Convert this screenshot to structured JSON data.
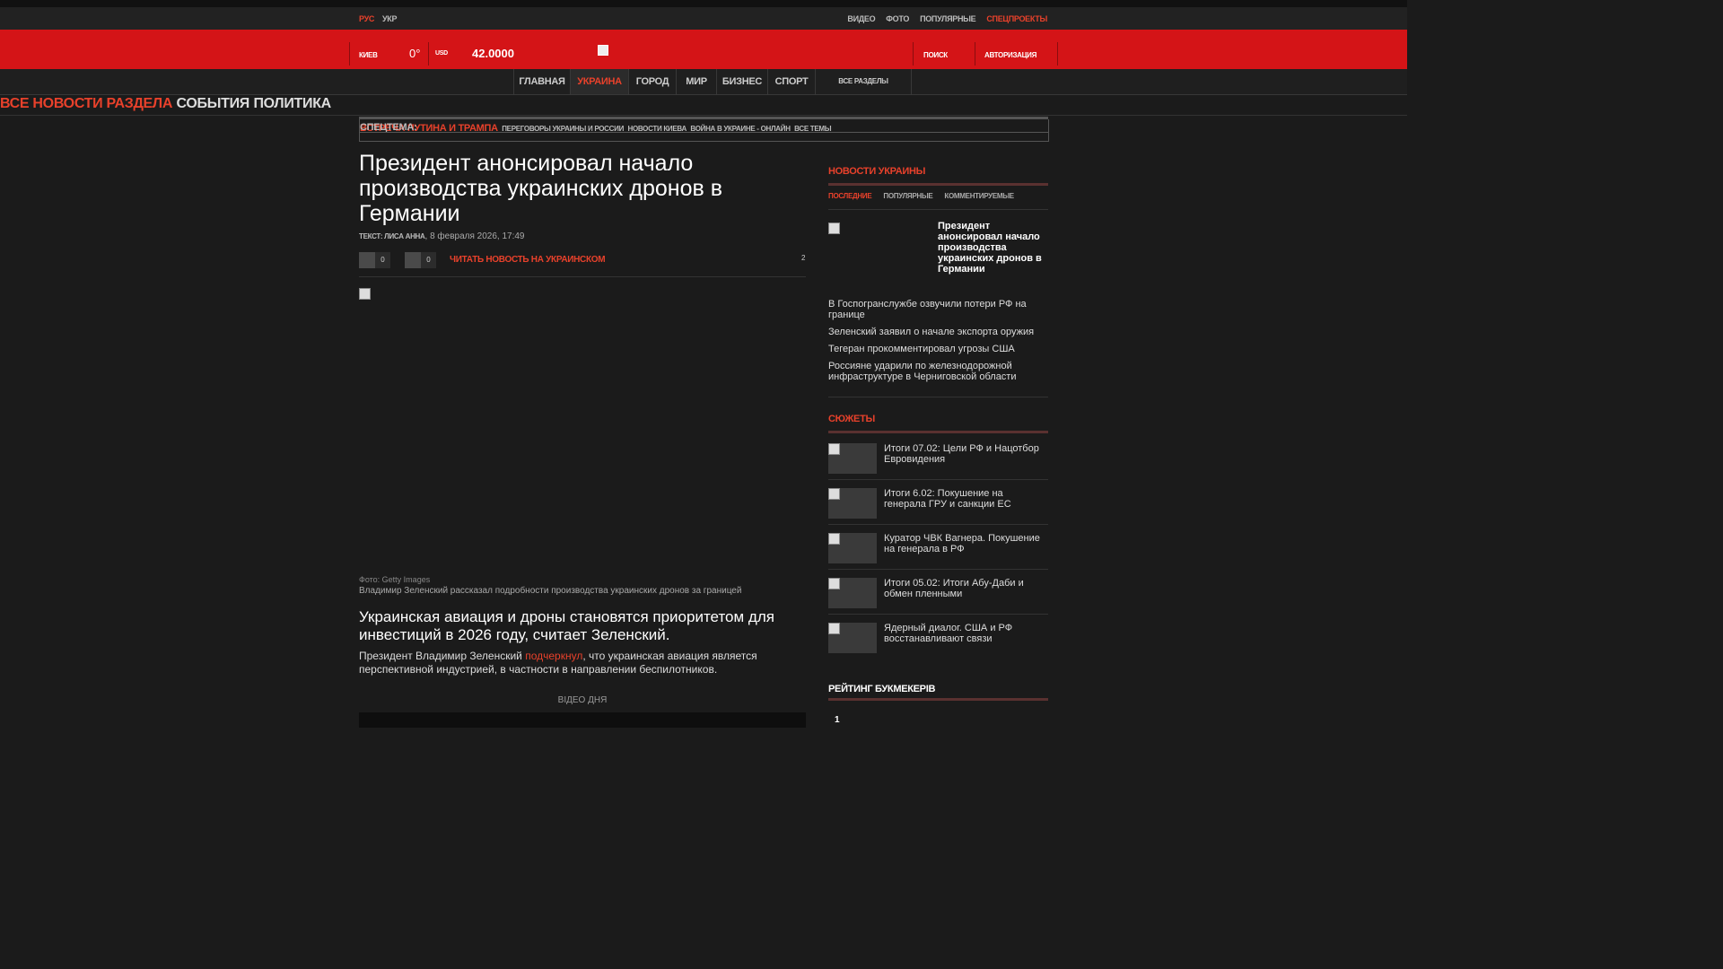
{
  "topbar": {
    "lang_rus": "РУС",
    "lang_ukr": "УКР",
    "links": [
      "ВИДЕО",
      "ФОТО",
      "ПОПУЛЯРНЫЕ",
      "СПЕЦПРОЕКТЫ"
    ]
  },
  "header": {
    "city": "КИЕВ",
    "temperature": "0°",
    "currency_label": "USD",
    "currency_value": "42.0000",
    "search": "ПОИСК",
    "auth": "АВТОРИЗАЦИЯ"
  },
  "nav": {
    "items": [
      "ГЛАВНАЯ",
      "УКРАИНА",
      "ГОРОД",
      "МИР",
      "БИЗНЕС",
      "СПОРТ"
    ],
    "all_sections": "ВСЕ РАЗДЕЛЫ"
  },
  "subnav": {
    "all": "ВСЕ НОВОСТИ РАЗДЕЛА",
    "events": "СОБЫТИЯ",
    "politics": "ПОЛИТИКА"
  },
  "special": {
    "label": "СПЕЦТЕМА:",
    "main": "ВСТРЕЧА ПУТИНА И ТРАМПА",
    "links": [
      "ПЕРЕГОВОРЫ УКРАИНЫ И РОССИИ",
      "НОВОСТИ КИЕВА",
      "ВОЙНА В УКРАИНЕ - ОНЛАЙН"
    ],
    "all": "ВСЕ ТЕМЫ"
  },
  "article": {
    "title": "Президент анонсировал начало производства украинских дронов в Германии",
    "author": "ТЕКСТ: ЛИСА АННА",
    "date": "8 февраля 2026, 17:49",
    "likes_1": "0",
    "likes_2": "0",
    "read_ukr": "ЧИТАТЬ НОВОСТЬ НА УКРАИНСКОМ",
    "comments": "2",
    "photo_credit": "Фото: Getty Images",
    "photo_caption": "Владимир Зеленский рассказал подробности производства украинских дронов за границей",
    "lead": "Украинская авиация и дроны становятся приоритетом для инвестиций в 2026 году, считает Зеленский.",
    "body_before": "Президент Владимир Зеленский ",
    "body_link": "подчеркнул",
    "body_after": ", что украинская авиация является перспективной индустрией, в частности в направлении беспилотников.",
    "video_label": "ВІДЕО ДНЯ"
  },
  "sidebar": {
    "news_title": "НОВОСТИ УКРАИНЫ",
    "tabs": [
      "ПОСЛЕДНИЕ",
      "ПОПУЛЯРНЫЕ",
      "КОММЕНТИРУЕМЫЕ"
    ],
    "featured": "Президент анонсировал начало производства украинских дронов в Германии",
    "news": [
      "В Госпогранслужбе озвучили потери РФ на границе",
      "Зеленский заявил о начале экспорта оружия",
      "Тегеран прокомментировал угрозы США",
      "Россияне ударили по железнодорожной инфраструктуре в Черниговской области"
    ],
    "stories_title": "СЮЖЕТЫ",
    "stories": [
      "Итоги 07.02: Цели РФ и Нацотбор Евровидения",
      "Итоги 6.02: Покушение на генерала ГРУ и санкции ЕС",
      "Куратор ЧВК Вагнера. Покушение на генерала в РФ",
      "Итоги 05.02: Итоги Абу-Даби и обмен пленными",
      "Ядерный диалог. США и РФ восстанавливают связи"
    ],
    "rating_title": "РЕЙТИНГ БУКМЕКЕРІВ",
    "rating_first": "1"
  },
  "colors": {
    "accent": "#e8412b",
    "header_red": "#d41417",
    "background": "#1b1b1b"
  }
}
